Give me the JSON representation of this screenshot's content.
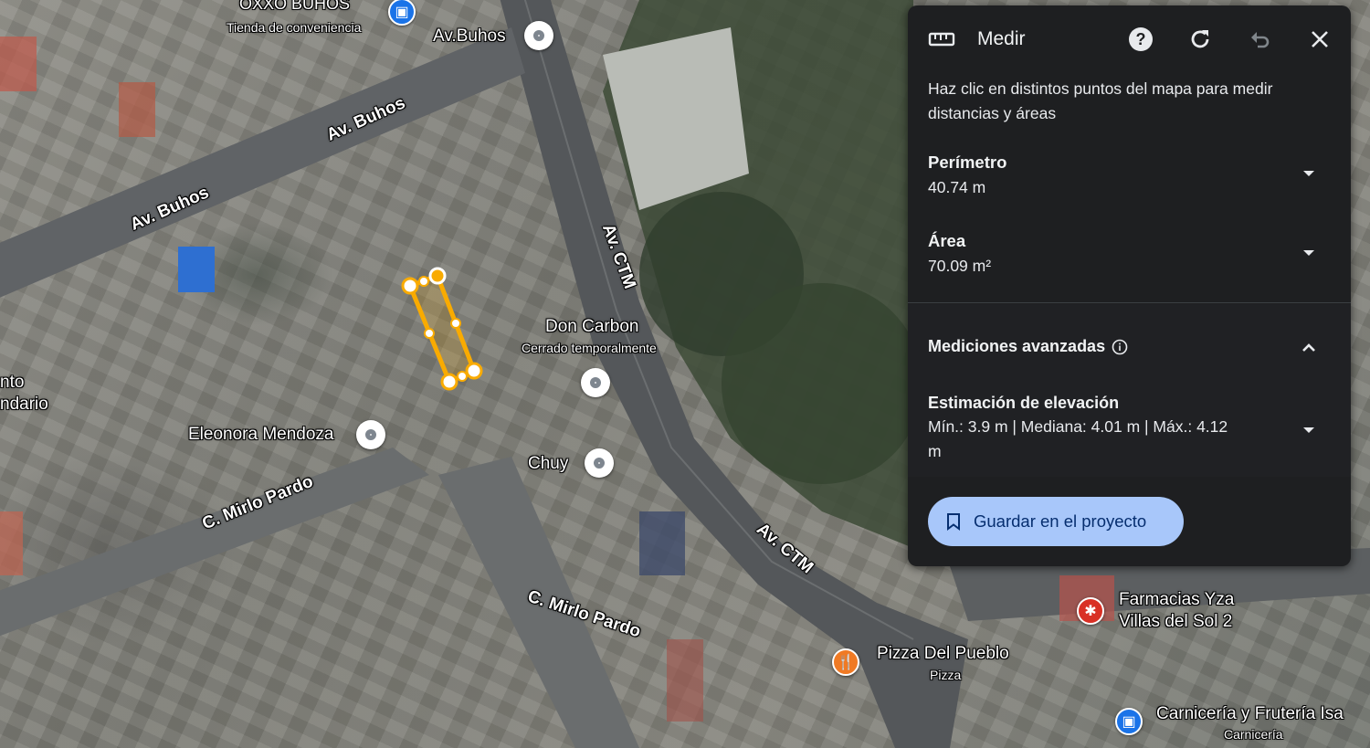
{
  "panel": {
    "title": "Medir",
    "hint": "Haz clic en distintos puntos del mapa para medir distancias y áreas",
    "perimeter": {
      "label": "Perímetro",
      "value": "40.74 m"
    },
    "area": {
      "label": "Área",
      "value": "70.09 m²"
    },
    "advanced": {
      "label": "Mediciones avanzadas"
    },
    "elevation": {
      "label": "Estimación de elevación",
      "value": "Mín.: 3.9 m | Mediana: 4.01 m | Máx.: 4.12 m"
    },
    "save_label": "Guardar en el proyecto"
  },
  "map": {
    "streets": [
      "Av. Buhos",
      "Av. Buhos",
      "Av. CTM",
      "Av. CTM",
      "C. Mirlo Pardo",
      "C. Mirlo Pardo"
    ],
    "places": {
      "oxxo": {
        "name": "OXXO BUHOS",
        "sub": "Tienda de conveniencia"
      },
      "avbuhos_pin": "Av.Buhos",
      "doncarbon": {
        "name": "Don Carbon",
        "sub": "Cerrado temporalmente"
      },
      "eleonora": "Eleonora Mendoza",
      "chuy": "Chuy",
      "farmacias": {
        "line1": "Farmacias Yza",
        "line2": "Villas del Sol 2"
      },
      "pizza": {
        "name": "Pizza Del Pueblo",
        "sub": "Pizza"
      },
      "carniceria": {
        "name": "Carnicería y Frutería Isa",
        "sub": "Carnicería"
      },
      "partial": {
        "line1": "nto",
        "line2": "ndario"
      }
    }
  },
  "colors": {
    "accent": "#a8c7fa",
    "measure": "#f9ab00",
    "panel_bg": "#1e1f21"
  }
}
